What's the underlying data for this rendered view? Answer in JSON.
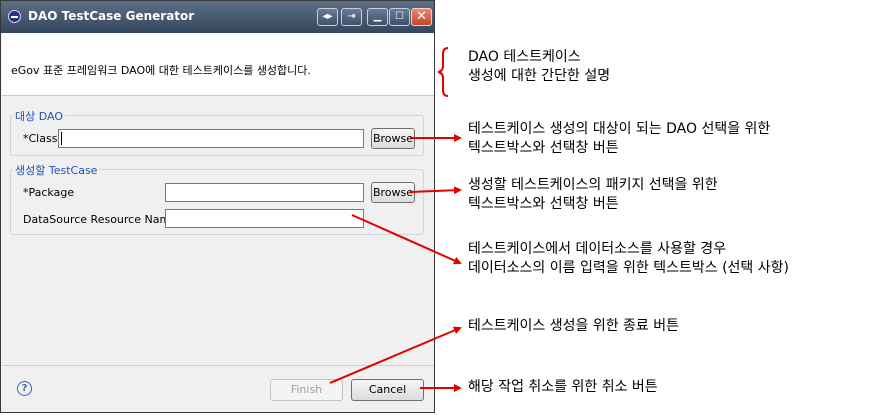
{
  "window": {
    "title": "DAO TestCase Generator",
    "buttons": {
      "restore_glyph": "◂▸",
      "menu_glyph": "⇥",
      "minimize_glyph": "▁",
      "maximize_glyph": "☐",
      "close_glyph": "✕"
    }
  },
  "header": {
    "description": "eGov 표준 프레임워크 DAO에 대한 테스트케이스를 생성합니다."
  },
  "target_group": {
    "label": "대상 DAO",
    "class_label": "*Class",
    "class_value": "",
    "browse_label": "Browse"
  },
  "testcase_group": {
    "label": "생성할 TestCase",
    "package_label": "*Package",
    "package_value": "",
    "browse_label": "Browse",
    "datasource_label": "DataSource Resource Name",
    "datasource_value": ""
  },
  "footer": {
    "help_glyph": "?",
    "finish_label": "Finish",
    "cancel_label": "Cancel"
  },
  "annotations": {
    "header_line1": "DAO 테스트케이스",
    "header_line2": "생성에 대한 간단한 설명",
    "class_line1": "테스트케이스 생성의 대상이 되는 DAO 선택을 위한",
    "class_line2": "텍스트박스와 선택창 버튼",
    "package_line1": "생성할 테스트케이스의 패키지 선택을 위한",
    "package_line2": "텍스트박스와 선택창 버튼",
    "datasource_line1": "테스트케이스에서 데이터소스를 사용할 경우",
    "datasource_line2": "데이터소스의 이름 입력을 위한 텍스트박스 (선택 사항)",
    "finish_line1": "테스트케이스 생성을 위한 종료 버튼",
    "cancel_line1": "해당 작업 취소를 위한 취소 버튼"
  },
  "colors": {
    "arrow": "#e00000",
    "brace": "#e00000",
    "group_label": "#1f4fb8",
    "titlebar": "#34465c"
  }
}
